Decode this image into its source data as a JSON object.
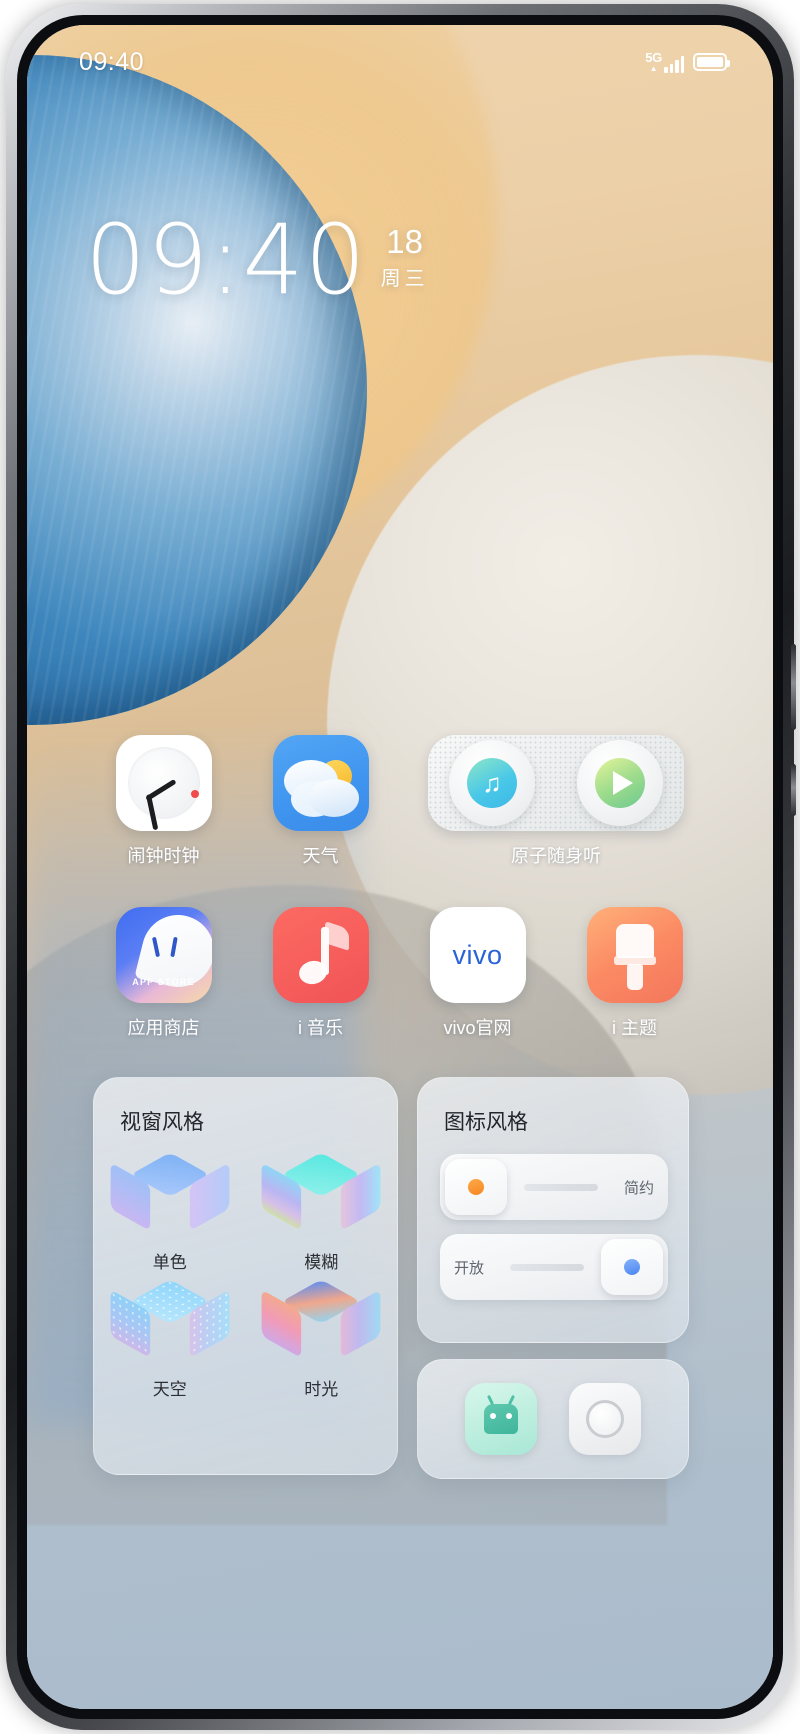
{
  "status_bar": {
    "time": "09:40",
    "network_label": "5G",
    "network_arrow": "▲",
    "signal_icon": "signal-bars-icon",
    "battery_icon": "battery-full-icon"
  },
  "clock_widget": {
    "time": "09:40",
    "day": "18",
    "weekday": "周三"
  },
  "apps": {
    "row1": [
      {
        "label": "闹钟时钟",
        "icon": "alarm-clock-icon"
      },
      {
        "label": "天气",
        "icon": "weather-cloud-sun-icon"
      },
      {
        "label": "原子随身听",
        "icon": "atomic-music-player-icon"
      }
    ],
    "row2": [
      {
        "label": "应用商店",
        "icon": "app-store-icon",
        "badge_text": "APP STORE"
      },
      {
        "label": "i 音乐",
        "icon": "music-note-icon"
      },
      {
        "label": "vivo官网",
        "icon": "vivo-logo-icon",
        "wordmark": "vivo"
      },
      {
        "label": "i 主题",
        "icon": "paint-brush-icon"
      }
    ]
  },
  "widgets": {
    "window_style": {
      "title": "视窗风格",
      "items": [
        {
          "label": "单色",
          "icon": "cube-monochrome-icon"
        },
        {
          "label": "模糊",
          "icon": "cube-blur-icon"
        },
        {
          "label": "天空",
          "icon": "cube-sky-icon"
        },
        {
          "label": "时光",
          "icon": "cube-time-icon"
        }
      ]
    },
    "icon_style": {
      "title": "图标风格",
      "toggles": [
        {
          "label": "简约",
          "state": "left",
          "accent": "#f5871f"
        },
        {
          "label": "开放",
          "state": "right",
          "accent": "#4a86f0"
        }
      ]
    },
    "preview": {
      "tiles": [
        {
          "icon": "android-robot-icon"
        },
        {
          "icon": "camera-lens-icon"
        }
      ]
    }
  },
  "colors": {
    "accent_blue": "#2a63d8",
    "accent_orange": "#f5871f",
    "weather_blue": "#3f94ef",
    "music_red": "#f75f5c",
    "theme_orange": "#fb8a63"
  }
}
